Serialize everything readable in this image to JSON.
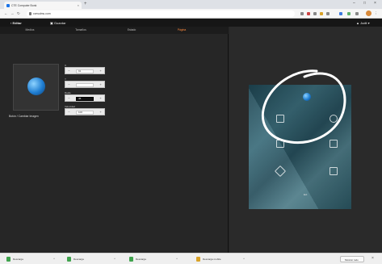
{
  "browser": {
    "tab_title": "CTE Computer Bonk",
    "url": "cvnsulmu.com",
    "colors": {
      "accent": "#ff8a3d"
    }
  },
  "header": {
    "back_label": "‹ Editar",
    "save_label": "▣ Guardar",
    "user_label": "▲ Judit ▾"
  },
  "subtabs": [
    "Medios",
    "Tamaños",
    "Estado",
    "Página"
  ],
  "image_card": {
    "caption": "Botón / Cambiar Imagen",
    "icon": "globe-icon"
  },
  "fields": [
    {
      "label": "X",
      "value": "91"
    },
    {
      "label": "Y",
      "value": ""
    },
    {
      "label": "Radio",
      "value": "45"
    },
    {
      "label": "Velocidad",
      "value": "100"
    }
  ],
  "preview": {
    "bottom_label": "Ext"
  },
  "downloads": [
    "Descarga",
    "Descarga",
    "Descarga",
    "Descarga mobile"
  ],
  "download_bar": {
    "show_all": "Mostrar todo",
    "close": "×"
  }
}
